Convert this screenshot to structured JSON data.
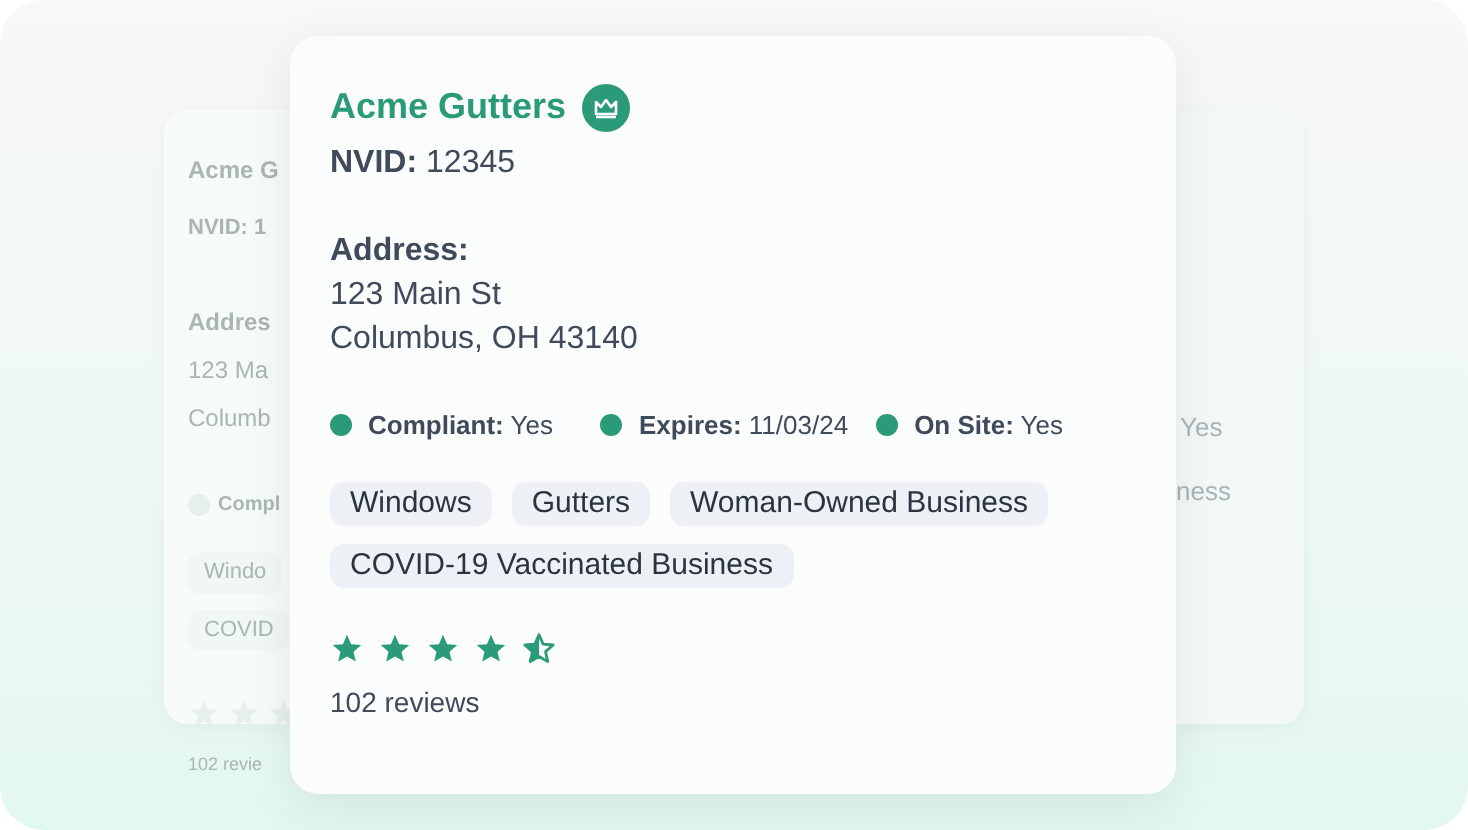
{
  "back_left_card": {
    "title": "Acme G",
    "nvid_label": "NVID:",
    "nvid_value": "1",
    "address_label": "Addres",
    "address_lines": [
      "123 Ma",
      "Columb"
    ],
    "status": "Compl",
    "tags": [
      "Windo",
      "COVID"
    ],
    "reviews": "102 revie"
  },
  "back_right_card": {
    "status_value": "Yes",
    "tag": "ness"
  },
  "card": {
    "title": "Acme Gutters",
    "premium": true,
    "nvid_label": "NVID:",
    "nvid_value": "12345",
    "address_label": "Address:",
    "address_lines": [
      "123 Main St",
      "Columbus, OH 43140"
    ],
    "statuses": [
      {
        "label": "Compliant:",
        "value": "Yes",
        "color": "#2a9a78"
      },
      {
        "label": "Expires:",
        "value": "11/03/24",
        "color": "#2a9a78"
      },
      {
        "label": "On Site:",
        "value": "Yes",
        "color": "#2a9a78"
      }
    ],
    "tags": [
      "Windows",
      "Gutters",
      "Woman-Owned Business",
      "COVID-19 Vaccinated Business"
    ],
    "stars": 4.5,
    "reviews": "102 reviews"
  }
}
